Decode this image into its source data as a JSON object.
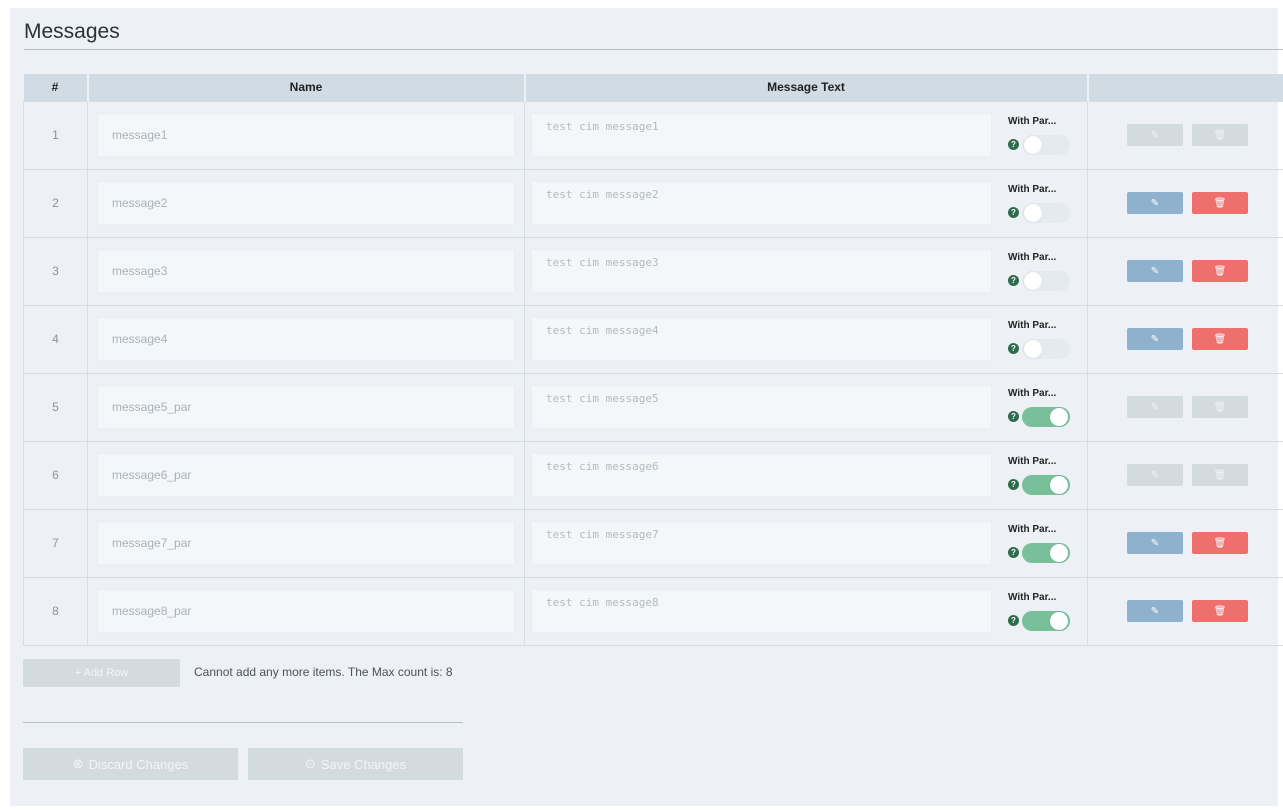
{
  "page": {
    "title": "Messages"
  },
  "table": {
    "headers": {
      "index": "#",
      "name": "Name",
      "message_text": "Message Text",
      "actions": ""
    },
    "param_label": "With Par...",
    "help_icon_label": "?",
    "edit_icon": "edit-icon",
    "delete_icon": "trash-icon",
    "rows": [
      {
        "index": "1",
        "name": "message1",
        "text": "test cim message1",
        "with_params": false,
        "actions_enabled": false
      },
      {
        "index": "2",
        "name": "message2",
        "text": "test cim message2",
        "with_params": false,
        "actions_enabled": true
      },
      {
        "index": "3",
        "name": "message3",
        "text": "test cim message3",
        "with_params": false,
        "actions_enabled": true
      },
      {
        "index": "4",
        "name": "message4",
        "text": "test cim message4",
        "with_params": false,
        "actions_enabled": true
      },
      {
        "index": "5",
        "name": "message5_par",
        "text": "test cim message5",
        "with_params": true,
        "actions_enabled": false
      },
      {
        "index": "6",
        "name": "message6_par",
        "text": "test cim message6",
        "with_params": true,
        "actions_enabled": false
      },
      {
        "index": "7",
        "name": "message7_par",
        "text": "test cim message7",
        "with_params": true,
        "actions_enabled": true
      },
      {
        "index": "8",
        "name": "message8_par",
        "text": "test cim message8",
        "with_params": true,
        "actions_enabled": true
      }
    ]
  },
  "add_row": {
    "label": "+ Add Row",
    "max_message": "Cannot add any more items. The Max count is: 8"
  },
  "footer": {
    "discard_label": "Discard Changes",
    "save_label": "Save Changes"
  },
  "colors": {
    "edit": "#8eb1cd",
    "delete": "#ef6e6e",
    "toggle_on": "#78bf9a",
    "disabled": "#d3dbe0"
  }
}
